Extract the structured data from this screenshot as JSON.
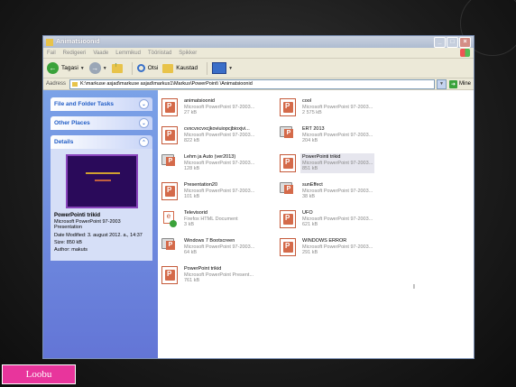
{
  "window": {
    "title": "Animatsioonid"
  },
  "menu": [
    "Fail",
    "Redigeeri",
    "Vaade",
    "Lemmikud",
    "Tööriistad",
    "Spikker"
  ],
  "toolbar": {
    "back_label": "Tagasi",
    "search_label": "Otsi",
    "folders_label": "Kaustad"
  },
  "address": {
    "label": "Aadress",
    "path": "K:\\markuse asjad\\markuse asjad\\markus1\\Markus\\PowerPoint\\ \\Animatsioonid",
    "go_label": "Mine"
  },
  "taskpane": {
    "panels": [
      "File and Folder Tasks",
      "Other Places",
      "Details"
    ],
    "details": {
      "name": "PowerPointi trikid",
      "type": "Microsoft PowerPoint 97-2003 Presentation",
      "modified": "Date Modified: 3. august 2012. a., 14:37",
      "size": "Size: 850 kB",
      "author": "Author: makuts"
    }
  },
  "files": [
    {
      "name": "animatsioonid",
      "type": "Microsoft PowerPoint 97-2003...",
      "size": "27 kB",
      "icon": "ppt"
    },
    {
      "name": "cool",
      "type": "Microsoft PowerPoint 97-2003...",
      "size": "2 575 kB",
      "icon": "ppt"
    },
    {
      "name": "cvxcvxcvxcjkoviuiopcjbioxjvi...",
      "type": "Microsoft PowerPoint 97-2003...",
      "size": "822 kB",
      "icon": "ppt"
    },
    {
      "name": "ERT 2013",
      "type": "Microsoft PowerPoint 97-2003...",
      "size": "204 kB",
      "icon": "ppt-shared"
    },
    {
      "name": "Lehm ja Auto (ver2013)",
      "type": "Microsoft PowerPoint 97-2003...",
      "size": "128 kB",
      "icon": "ppt-shared"
    },
    {
      "name": "PowerPointi trikid",
      "type": "Microsoft PowerPoint 97-2003...",
      "size": "851 kB",
      "icon": "ppt",
      "selected": true
    },
    {
      "name": "Presentation20",
      "type": "Microsoft PowerPoint 97-2003...",
      "size": "101 kB",
      "icon": "ppt"
    },
    {
      "name": "sunEffect",
      "type": "Microsoft PowerPoint 97-2003...",
      "size": "38 kB",
      "icon": "ppt-shared"
    },
    {
      "name": "Televisorid",
      "type": "Firefox HTML Document",
      "size": "3 kB",
      "icon": "html"
    },
    {
      "name": "UFO",
      "type": "Microsoft PowerPoint 97-2003...",
      "size": "621 kB",
      "icon": "ppt"
    },
    {
      "name": "Windows 7 Bootscreen",
      "type": "Microsoft PowerPoint 97-2003...",
      "size": "64 kB",
      "icon": "ppt-shared"
    },
    {
      "name": "WINDOWS ERROR",
      "type": "Microsoft PowerPoint 97-2003...",
      "size": "291 kB",
      "icon": "ppt"
    },
    {
      "name": "PowerPoint trikid",
      "type": "Microsoft PowerPoint Present...",
      "size": "761 kB",
      "icon": "ppt"
    }
  ],
  "cancel_label": "Loobu"
}
